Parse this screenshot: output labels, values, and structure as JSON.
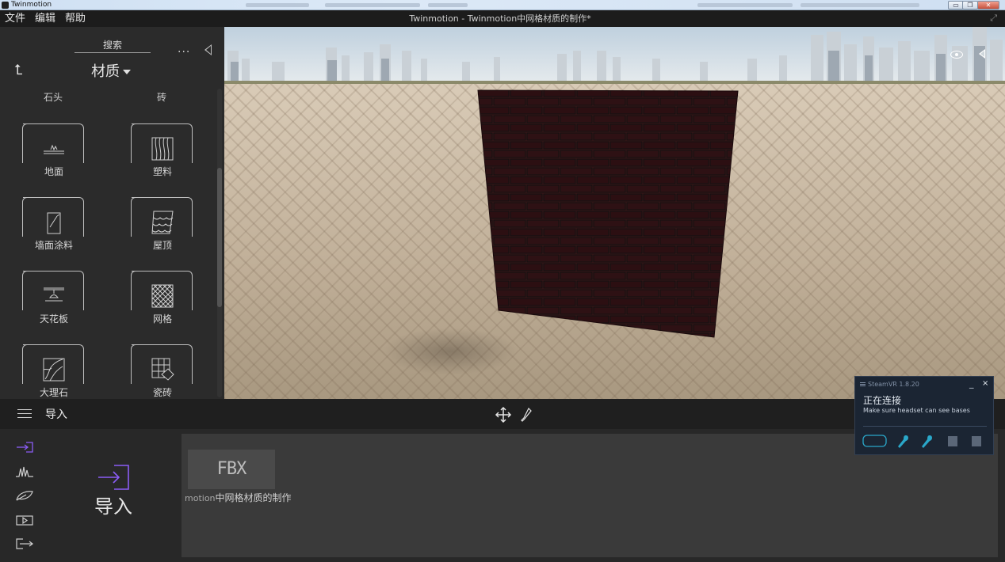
{
  "os_window": {
    "title": "Twinmotion",
    "min_icon": "minimize-icon",
    "max_icon": "maximize-icon",
    "close_icon": "close-icon",
    "min_glyph": "▭",
    "max_glyph": "❐",
    "close_glyph": "✕"
  },
  "menu": {
    "file": "文件",
    "edit": "编辑",
    "help": "帮助",
    "document_title": "Twinmotion - Twinmotion中网格材质的制作*",
    "expand_glyph": "⤢"
  },
  "library": {
    "search_label": "搜索",
    "more_glyph": "...",
    "back_glyph": "⮤",
    "category": "材质",
    "subcategories": [
      "石头",
      "砖"
    ],
    "materials": [
      {
        "label": "地面",
        "icon": "ground-icon"
      },
      {
        "label": "塑料",
        "icon": "plastic-icon"
      },
      {
        "label": "墙面涂料",
        "icon": "wall-paint-icon"
      },
      {
        "label": "屋顶",
        "icon": "roof-icon"
      },
      {
        "label": "天花板",
        "icon": "ceiling-icon"
      },
      {
        "label": "网格",
        "icon": "grid-icon"
      },
      {
        "label": "大理石",
        "icon": "marble-icon"
      },
      {
        "label": "瓷砖",
        "icon": "tile-icon"
      }
    ]
  },
  "toolbar": {
    "section_title": "导入"
  },
  "import_panel": {
    "big_label": "导入",
    "nav_icons": [
      "import-icon",
      "waveform-icon",
      "leaf-icon",
      "media-icon",
      "export-icon"
    ],
    "file": {
      "tile_label": "FBX",
      "name_prefix": "motion",
      "name": "中网格材质的制作"
    }
  },
  "steamvr": {
    "title": "SteamVR 1.8.20",
    "minimize": "_",
    "close": "×",
    "status": "正在连接",
    "message": "Make sure headset can see bases",
    "devices": [
      "headset-icon",
      "controller-icon",
      "controller-icon",
      "base-station-icon",
      "base-station-icon"
    ]
  },
  "colors": {
    "accent_purple": "#8b5cf6",
    "steamvr_accent": "#2aa7c9",
    "brick": "#3a1518"
  }
}
